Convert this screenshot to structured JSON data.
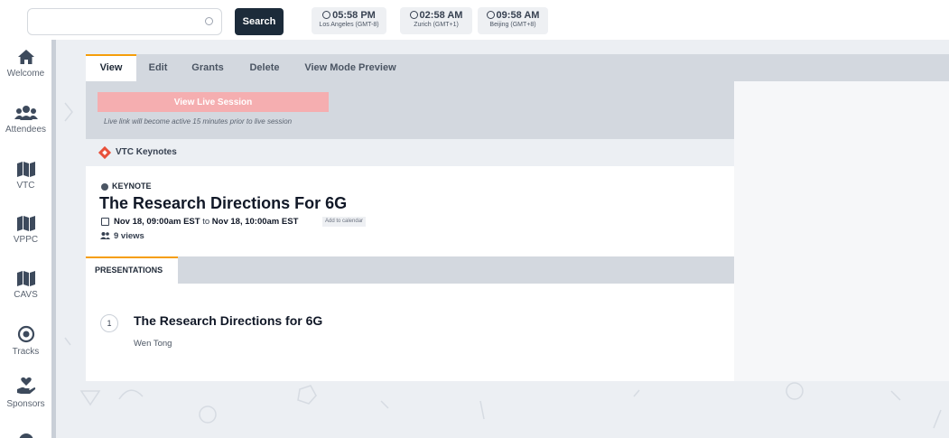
{
  "topbar": {
    "search": {
      "value": "",
      "placeholder": ""
    },
    "search_label": "Search",
    "clocks": [
      {
        "time": "05:58 PM",
        "zone": "Los Angeles (GMT-8)"
      },
      {
        "time": "02:58 AM",
        "zone": "Zurich (GMT+1)"
      },
      {
        "time": "09:58 AM",
        "zone": "Beijing (GMT+8)"
      }
    ]
  },
  "sidebar": {
    "items": [
      {
        "label": "Welcome",
        "icon": "home-icon"
      },
      {
        "label": "Attendees",
        "icon": "users-icon"
      },
      {
        "label": "VTC",
        "icon": "map-icon"
      },
      {
        "label": "VPPC",
        "icon": "map-icon"
      },
      {
        "label": "CAVS",
        "icon": "map-icon"
      },
      {
        "label": "Tracks",
        "icon": "target-icon"
      },
      {
        "label": "Sponsors",
        "icon": "hand-heart-icon"
      }
    ]
  },
  "tabs": [
    {
      "label": "View",
      "active": true
    },
    {
      "label": "Edit"
    },
    {
      "label": "Grants"
    },
    {
      "label": "Delete"
    },
    {
      "label": "View Mode Preview"
    }
  ],
  "live": {
    "button_label": "View Live Session",
    "note": "Live link will become active 15 minutes prior to live session"
  },
  "track": {
    "name": "VTC Keynotes",
    "icon": "diamond-icon",
    "color": "#e8503a"
  },
  "session": {
    "type": "KEYNOTE",
    "title": "The Research Directions For 6G",
    "start": "Nov 18, 09:00am EST",
    "to": "to",
    "end": "Nov 18, 10:00am EST",
    "add_to_calendar": "Add to calendar",
    "views": "9 views"
  },
  "presentations": {
    "tab_label": "PRESENTATIONS",
    "items": [
      {
        "number": "1",
        "title": "The Research Directions for 6G",
        "author": "Wen Tong"
      }
    ]
  },
  "colors": {
    "accent": "#f59e0b",
    "live_button": "#f5aeb0",
    "dark_button": "#1c2b3a",
    "sidebar_icon": "#3d4a5c"
  }
}
